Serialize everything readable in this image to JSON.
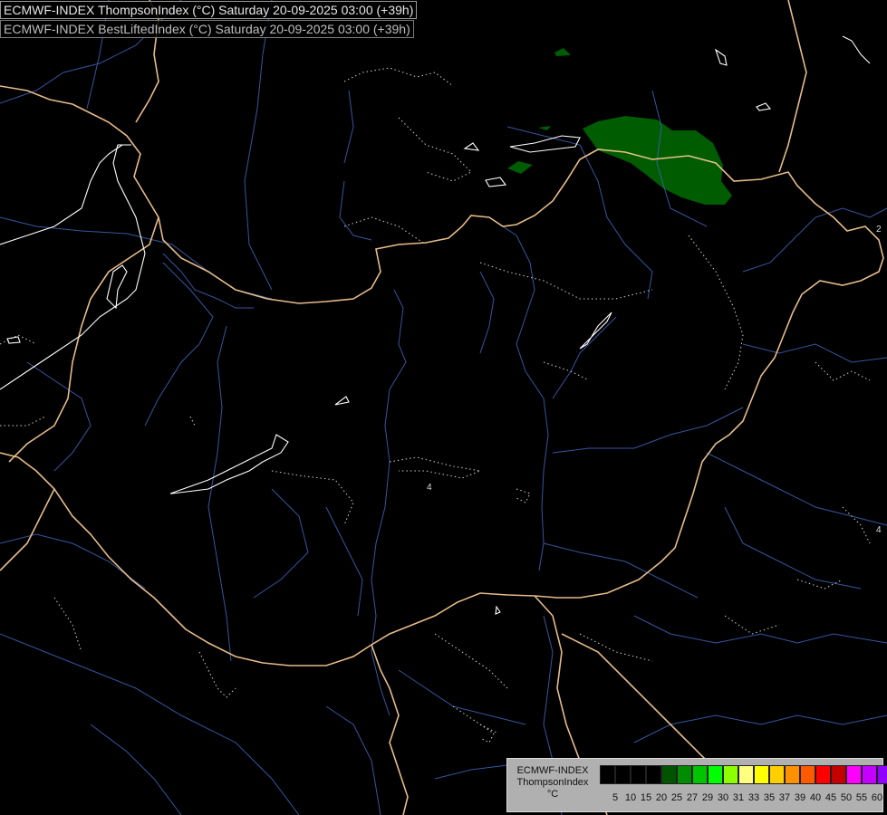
{
  "title": {
    "line1": "ECMWF-INDEX ThompsonIndex (°C) Saturday 20-09-2025 03:00 (+39h)",
    "line2": "ECMWF-INDEX BestLiftedIndex (°C) Saturday 20-09-2025 03:00 (+39h)"
  },
  "legend": {
    "model": "ECMWF-INDEX",
    "parameter": "ThompsonIndex",
    "unit": "°C",
    "colors": [
      "#000000",
      "#000000",
      "#000000",
      "#000000",
      "#005400",
      "#008b00",
      "#00c400",
      "#00ff00",
      "#8cff00",
      "#ffff7f",
      "#ffff00",
      "#ffcf00",
      "#ff9000",
      "#ff5a00",
      "#ff0000",
      "#c40000",
      "#ff00ff",
      "#c400ff",
      "#9000ff",
      "#5a00ff",
      "#0000ff"
    ],
    "ticks": [
      "5",
      "10",
      "15",
      "20",
      "25",
      "27",
      "29",
      "30",
      "31",
      "33",
      "35",
      "37",
      "39",
      "40",
      "45",
      "50",
      "55",
      "60"
    ]
  },
  "map_labels": {
    "contour_label_center": "4",
    "contour_label_right": "4",
    "contour_label_top_right": "2"
  },
  "colors": {
    "border": "#f2c690",
    "river": "#3d5fb0",
    "contour": "#ffffff",
    "green_fill": "#005c00"
  }
}
